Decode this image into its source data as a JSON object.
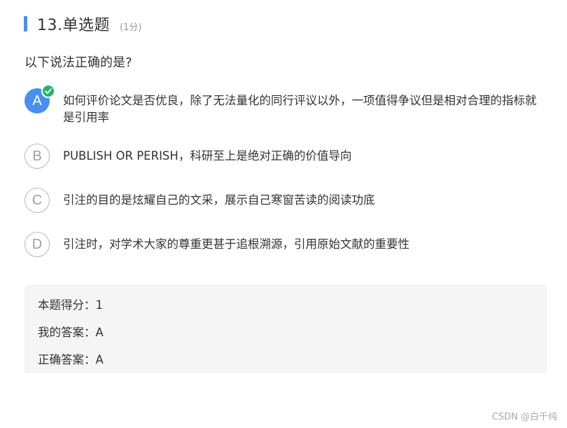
{
  "question": {
    "title": "13.单选题",
    "score": "(1分)",
    "stem": "以下说法正确的是?"
  },
  "options": [
    {
      "letter": "A",
      "text": "如何评价论文是否优良，除了无法量化的同行评议以外，一项值得争议但是相对合理的指标就是引用率",
      "selected": true
    },
    {
      "letter": "B",
      "text": "PUBLISH OR PERISH，科研至上是绝对正确的价值导向",
      "selected": false
    },
    {
      "letter": "C",
      "text": "引注的目的是炫耀自己的文采，展示自己寒窗苦读的阅读功底",
      "selected": false
    },
    {
      "letter": "D",
      "text": "引注时，对学术大家的尊重更甚于追根溯源，引用原始文献的重要性",
      "selected": false
    }
  ],
  "result": {
    "score_line": "本题得分：1",
    "my_answer_line": "我的答案：A",
    "correct_answer_line": "正确答案：A"
  },
  "watermark": "CSDN @白千纯",
  "colors": {
    "accent": "#4a8ff0",
    "check": "#24b36b",
    "result_bg": "#f5f5f5"
  },
  "icons": {
    "correct_badge": "check-circle-icon"
  }
}
